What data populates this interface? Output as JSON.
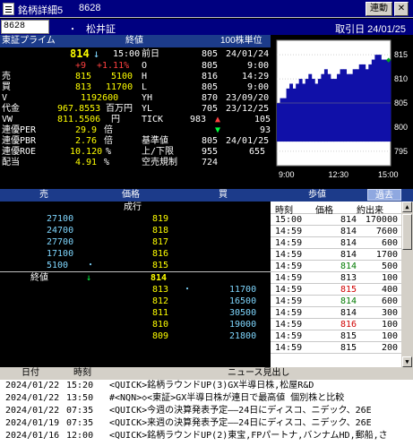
{
  "window": {
    "title": "銘柄詳細5",
    "code_display": "8628",
    "link_label": "連動",
    "close_label": "✕"
  },
  "codebar": {
    "code_value": "8628",
    "dot": "・",
    "name": "松井証",
    "date_label": "取引日 24/01/25"
  },
  "quote_header": {
    "market": "東証プライム",
    "col_close": "終値",
    "col_unit": "100株単位"
  },
  "quote": {
    "price": "814",
    "arrow": "↓",
    "time": "15:00",
    "prev_label": "前日",
    "prev_val": "805",
    "prev_date": "24/01/24",
    "chg": "+9",
    "chg_pct": "+1.11%",
    "open_label": "O",
    "open_val": "805",
    "open_time": "9:00",
    "sell_label": "売",
    "sell_p": "815",
    "sell_q": "5100",
    "high_label": "H",
    "high_val": "816",
    "high_time": "14:29",
    "buy_label": "買",
    "buy_p": "813",
    "buy_q": "11700",
    "low_label": "L",
    "low_val": "805",
    "low_time": "9:00",
    "vol_label": "V",
    "vol_val": "1192600",
    "yh_label": "YH",
    "yh_val": "870",
    "yh_date": "23/09/20",
    "amt_label": "代金",
    "amt_val": "967.8553",
    "amt_unit": "百万円",
    "yl_label": "YL",
    "yl_val": "705",
    "yl_date": "23/12/25",
    "vw_label": "VW",
    "vw_val": "811.5506",
    "vw_unit": "円",
    "tick_label": "TICK",
    "tick_a": "983",
    "tick_b": "105",
    "per_label": "連優PER",
    "per_val": "29.9",
    "per_unit": "倍",
    "tick_c": "93",
    "pbr_label": "連優PBR",
    "pbr_val": "2.76",
    "pbr_unit": "倍",
    "base_label": "基準値",
    "base_val": "805",
    "base_date": "24/01/25",
    "roe_label": "連優ROE",
    "roe_val": "10.120",
    "roe_unit": "%",
    "lim_label": "上/下限",
    "lim_hi": "955",
    "lim_lo": "655",
    "div_label": "配当",
    "div_val": "4.91",
    "div_unit": "%",
    "short_label": "空売規制",
    "short_val": "724"
  },
  "chart_data": {
    "type": "bar",
    "ylim": [
      792,
      818
    ],
    "yticks": [
      795,
      800,
      805,
      810,
      815
    ],
    "xticks": [
      "9:00",
      "12:30",
      "15:00"
    ],
    "marker": "◆",
    "values": [
      805,
      806,
      806,
      808,
      809,
      808,
      809,
      810,
      809,
      810,
      811,
      810,
      809,
      810,
      811,
      812,
      811,
      810,
      810,
      811,
      812,
      812,
      811,
      811,
      812,
      812,
      813,
      813,
      812,
      813,
      814,
      815,
      815,
      814,
      814,
      814
    ]
  },
  "board_header": {
    "sell": "売",
    "price": "価格",
    "buy": "買"
  },
  "board": {
    "nari_label": "成行",
    "close_label": "終値",
    "close_arrow": "↓",
    "close_price": "814",
    "asks": [
      {
        "q": "27100",
        "p": "819"
      },
      {
        "q": "24700",
        "p": "818"
      },
      {
        "q": "27700",
        "p": "817"
      },
      {
        "q": "17100",
        "p": "816"
      },
      {
        "q": "5100",
        "p": "815"
      }
    ],
    "bids": [
      {
        "p": "813",
        "q": "11700"
      },
      {
        "p": "812",
        "q": "16500"
      },
      {
        "p": "811",
        "q": "30500"
      },
      {
        "p": "810",
        "q": "19000"
      },
      {
        "p": "809",
        "q": "21800"
      }
    ],
    "dot": "・"
  },
  "ticks_header": {
    "title": "歩値",
    "past_label": "過去"
  },
  "ticks_cols": {
    "time": "時刻",
    "price": "価格",
    "vol": "約出来"
  },
  "ticks": [
    {
      "t": "15:00",
      "p": "814",
      "v": "170000",
      "c": "#000000"
    },
    {
      "t": "14:59",
      "p": "814",
      "v": "7600",
      "c": "#000000"
    },
    {
      "t": "14:59",
      "p": "814",
      "v": "600",
      "c": "#000000"
    },
    {
      "t": "14:59",
      "p": "814",
      "v": "1700",
      "c": "#000000"
    },
    {
      "t": "14:59",
      "p": "814",
      "v": "500",
      "c": "#007a00"
    },
    {
      "t": "14:59",
      "p": "813",
      "v": "100",
      "c": "#000000"
    },
    {
      "t": "14:59",
      "p": "815",
      "v": "400",
      "c": "#d00000"
    },
    {
      "t": "14:59",
      "p": "814",
      "v": "600",
      "c": "#007a00"
    },
    {
      "t": "14:59",
      "p": "814",
      "v": "300",
      "c": "#000000"
    },
    {
      "t": "14:59",
      "p": "816",
      "v": "100",
      "c": "#d00000"
    },
    {
      "t": "14:59",
      "p": "815",
      "v": "100",
      "c": "#000000"
    },
    {
      "t": "14:59",
      "p": "815",
      "v": "200",
      "c": "#000000"
    }
  ],
  "news_header": {
    "date": "日付",
    "time": "時刻",
    "headline": "ニュース見出し"
  },
  "news": [
    {
      "d": "2024/01/22",
      "t": "15:20",
      "h": "<QUICK>銘柄ラウンドUP(3)GX半導日株,松屋R&D"
    },
    {
      "d": "2024/01/22",
      "t": "13:50",
      "h": "#<NQN>◇<東証>GX半導日株が連日で最高値 個別株と比較"
    },
    {
      "d": "2024/01/22",
      "t": "07:35",
      "h": "<QUICK>今週の決算発表予定——24日にディスコ、ニデック、26E"
    },
    {
      "d": "2024/01/19",
      "t": "07:35",
      "h": "<QUICK>来週の決算発表予定——24日にディスコ、ニデック、26E"
    },
    {
      "d": "2024/01/16",
      "t": "12:00",
      "h": "<QUICK>銘柄ラウンドUP(2)東宝,FPパートナ,バンナムHD,郵船,さ"
    }
  ]
}
